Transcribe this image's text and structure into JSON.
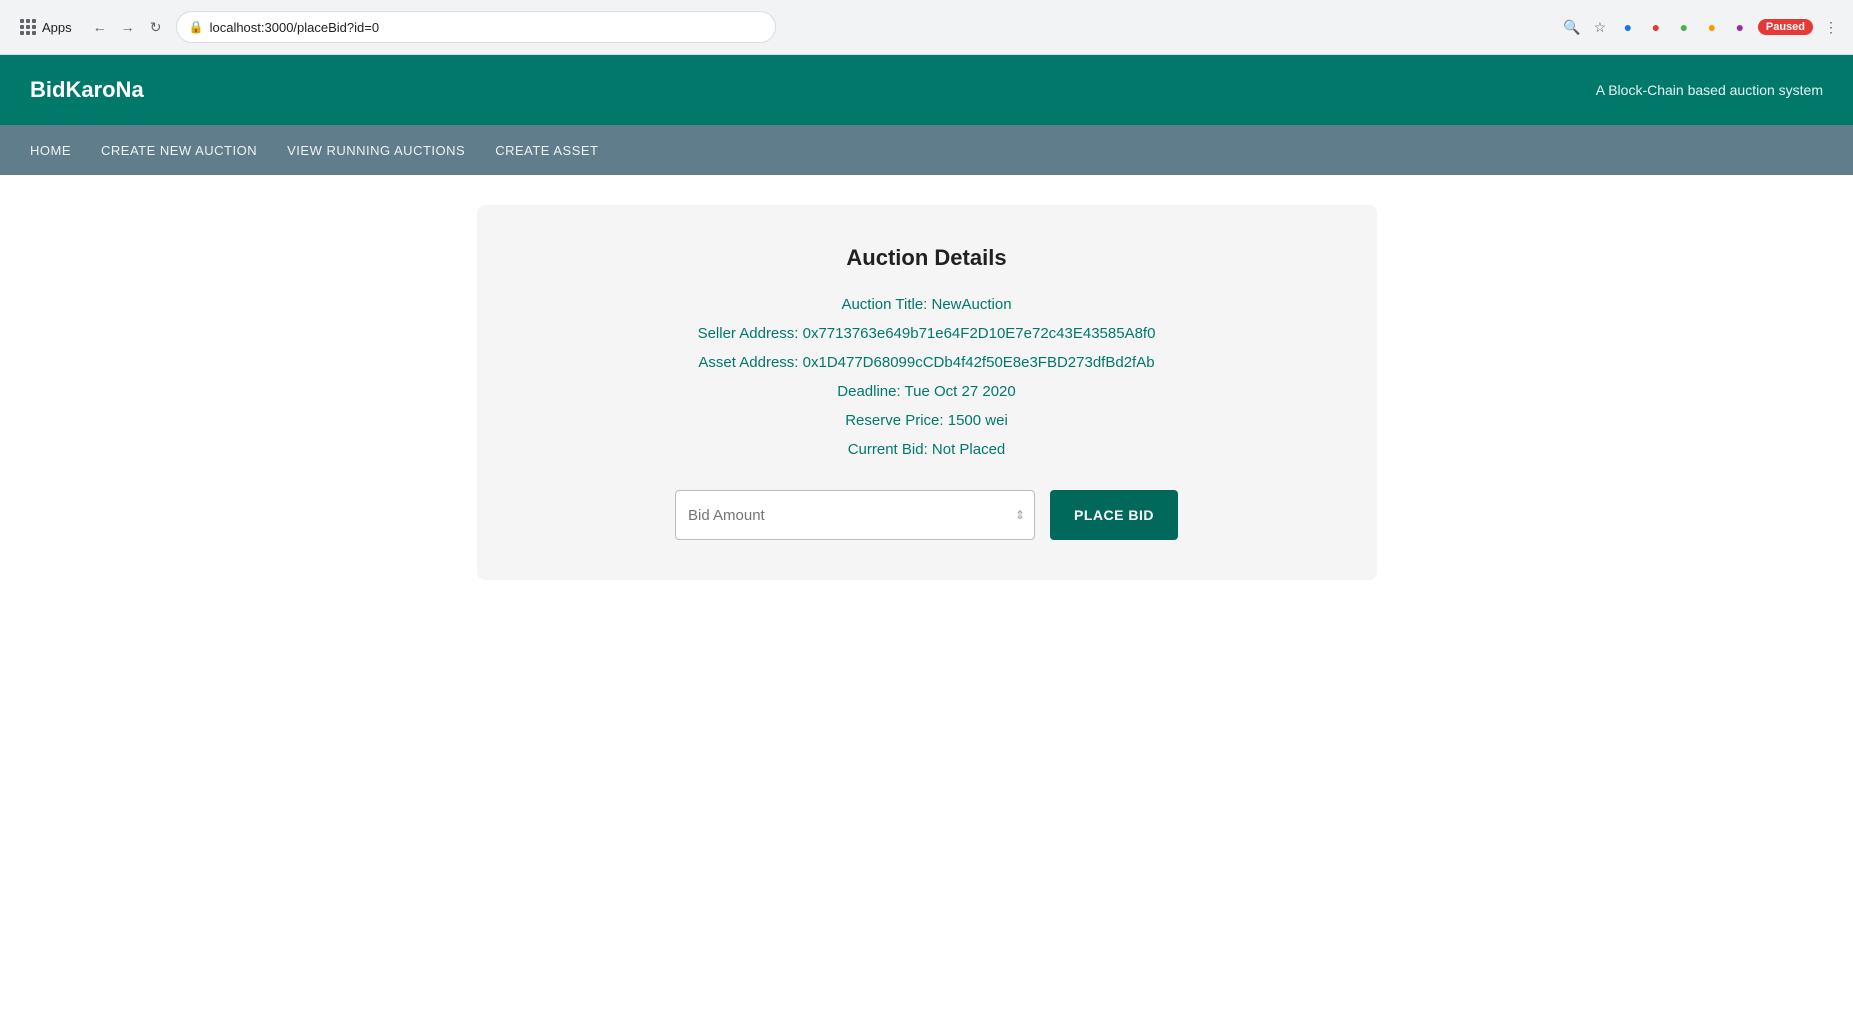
{
  "browser": {
    "url": "localhost:3000/placeBid?id=0",
    "apps_label": "Apps",
    "paused_label": "Paused"
  },
  "header": {
    "title": "BidKaroNa",
    "subtitle": "A Block-Chain based auction system"
  },
  "nav": {
    "items": [
      {
        "label": "HOME",
        "id": "home"
      },
      {
        "label": "CREATE NEW AUCTION",
        "id": "create-auction"
      },
      {
        "label": "VIEW RUNNING AUCTIONS",
        "id": "view-auctions"
      },
      {
        "label": "CREATE ASSET",
        "id": "create-asset"
      }
    ]
  },
  "auction": {
    "page_title": "Auction Details",
    "title_label": "Auction Title: NewAuction",
    "seller_label": "Seller Address: 0x7713763e649b71e64F2D10E7e72c43E43585A8f0",
    "asset_label": "Asset Address: 0x1D477D68099cCDb4f42f50E8e3FBD273dfBd2fAb",
    "deadline_label": "Deadline: Tue Oct 27 2020",
    "reserve_price_label": "Reserve Price: 1500 wei",
    "current_bid_label": "Current Bid: Not Placed",
    "bid_input_placeholder": "Bid Amount",
    "place_bid_button": "PLACE BID"
  }
}
